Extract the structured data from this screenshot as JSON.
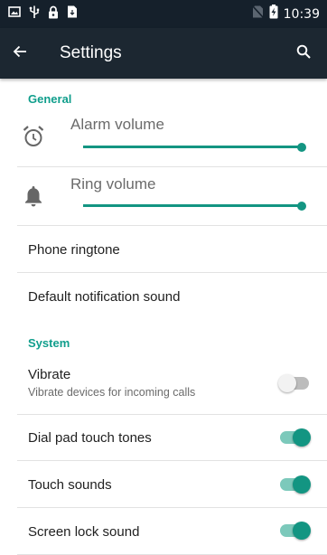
{
  "status_bar": {
    "time": "10:39",
    "left_icons": [
      "image-icon",
      "usb-icon",
      "lock-icon",
      "download-icon"
    ],
    "right_icons": [
      "no-sim-icon",
      "battery-charging-icon"
    ]
  },
  "app_bar": {
    "title": "Settings",
    "back_icon": "arrow-back-icon",
    "search_icon": "search-icon"
  },
  "sections": {
    "general": "General",
    "system": "System"
  },
  "volumes": [
    {
      "label": "Alarm volume",
      "icon": "alarm-clock-icon",
      "level": 1.0
    },
    {
      "label": "Ring volume",
      "icon": "bell-icon",
      "level": 1.0
    }
  ],
  "items": {
    "phone_ringtone": "Phone ringtone",
    "default_notification": "Default notification sound"
  },
  "toggles": [
    {
      "label": "Vibrate",
      "summary": "Vibrate devices for incoming calls",
      "on": false
    },
    {
      "label": "Dial pad touch tones",
      "summary": "",
      "on": true
    },
    {
      "label": "Touch sounds",
      "summary": "",
      "on": true
    },
    {
      "label": "Screen lock sound",
      "summary": "",
      "on": true
    }
  ],
  "colors": {
    "accent": "#139582",
    "section_header": "#109e8c",
    "app_bar": "#1c2731",
    "status_bar": "#15202b"
  }
}
